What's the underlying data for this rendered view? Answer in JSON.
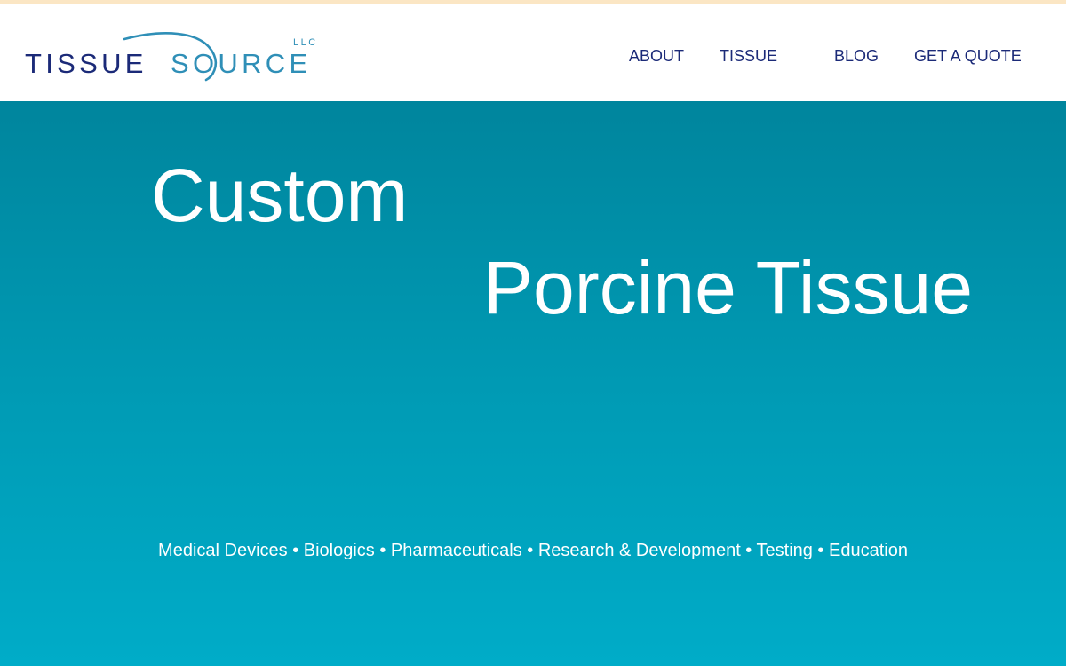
{
  "brand": {
    "word1": "TISSUE",
    "word2": "SOURCE",
    "suffix": "LLC",
    "primary_color": "#1b2a78",
    "accent_color": "#2f8fb7"
  },
  "nav": {
    "items": [
      {
        "label": "ABOUT"
      },
      {
        "label": "TISSUE"
      },
      {
        "label": "BLOG"
      },
      {
        "label": "GET A QUOTE"
      }
    ]
  },
  "hero": {
    "line1": "Custom",
    "line2": "Porcine Tissue",
    "tagline": "Medical Devices • Biologics • Pharmaceuticals • Research & Development • Testing • Education",
    "background_top": "#00859d",
    "background_bottom": "#00acc8"
  }
}
